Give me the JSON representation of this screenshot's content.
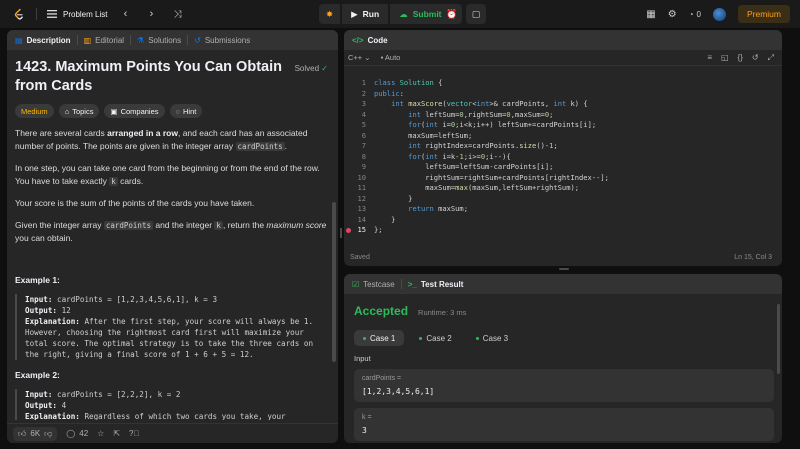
{
  "topbar": {
    "problem_list": "Problem List",
    "run": "Run",
    "submit": "Submit",
    "streak_count": "0",
    "premium": "Premium"
  },
  "left": {
    "tabs": [
      "Description",
      "Editorial",
      "Solutions",
      "Submissions"
    ],
    "title": "1423. Maximum Points You Can Obtain from Cards",
    "solved": "Solved",
    "chips": [
      "Medium",
      "Topics",
      "Companies",
      "Hint"
    ],
    "p1a": "There are several cards ",
    "p1b": "arranged in a row",
    "p1c": ", and each card has an associated number of points. The points are given in the integer array ",
    "p1code": "cardPoints",
    "p1d": ".",
    "p2a": "In one step, you can take one card from the beginning or from the end of the row. You have to take exactly ",
    "p2code": "k",
    "p2b": " cards.",
    "p3": "Your score is the sum of the points of the cards you have taken.",
    "p4a": "Given the integer array ",
    "p4code": "cardPoints",
    "p4b": " and the integer ",
    "p4code2": "k",
    "p4c": ", return the ",
    "p4em": "maximum score",
    "p4d": " you can obtain.",
    "ex1_h": "Example 1:",
    "ex1_input_l": "Input:",
    "ex1_input": " cardPoints = [1,2,3,4,5,6,1], k = 3",
    "ex1_output_l": "Output:",
    "ex1_output": " 12",
    "ex1_expl_l": "Explanation:",
    "ex1_expl": " After the first step, your score will always be 1. However, choosing the rightmost card first will maximize your total score. The optimal strategy is to take the three cards on the right, giving a final score of 1 + 6 + 5 = 12.",
    "ex2_h": "Example 2:",
    "ex2_input_l": "Input:",
    "ex2_input": " cardPoints = [2,2,2], k = 2",
    "ex2_output_l": "Output:",
    "ex2_output": " 4",
    "ex2_expl_l": "Explanation:",
    "ex2_expl": " Regardless of which two cards you take, your",
    "footer": {
      "likes": "6K",
      "comments": "42"
    }
  },
  "code": {
    "title": "Code",
    "lang": "C++",
    "auto": "Auto",
    "saved": "Saved",
    "cursor": "Ln 15, Col 3"
  },
  "result": {
    "tab_testcase": "Testcase",
    "tab_result": "Test Result",
    "status": "Accepted",
    "runtime": "Runtime: 3 ms",
    "cases": [
      "Case 1",
      "Case 2",
      "Case 3"
    ],
    "input_label": "Input",
    "var1_name": "cardPoints =",
    "var1_value": "[1,2,3,4,5,6,1]",
    "var2_name": "k =",
    "var2_value": "3"
  },
  "colors": {
    "accent": "#ffa116",
    "success": "#2cbb5d",
    "link": "#007aff"
  }
}
